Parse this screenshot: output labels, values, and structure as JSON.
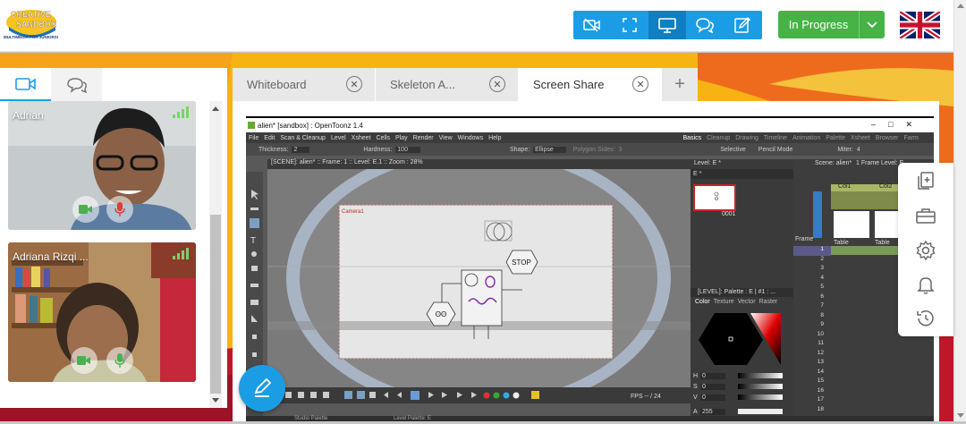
{
  "header": {
    "logo": {
      "line1": "CREATIVE",
      "line2": "SANDBOX",
      "tagline": "MULTIMEDIA FOR JUNIORS!"
    },
    "toolbar_icons": [
      "camera-off-icon",
      "fullscreen-icon",
      "screen-share-icon",
      "chat-icon",
      "edit-icon"
    ],
    "status": {
      "label": "In Progress"
    },
    "flag": "uk-flag-icon"
  },
  "left_panel": {
    "tabs": [
      "video-icon",
      "chat-icon"
    ],
    "participants": [
      {
        "name": "Adrian"
      },
      {
        "name": "Adriana Rizqi ..."
      }
    ]
  },
  "tabs": [
    {
      "label": "Whiteboard",
      "active": false
    },
    {
      "label": "Skeleton A...",
      "active": false
    },
    {
      "label": "Screen Share",
      "active": true
    }
  ],
  "add_tab_label": "+",
  "share": {
    "title": "alien* [sandbox] : OpenToonz 1.4",
    "menu": [
      "File",
      "Edit",
      "Scan & Cleanup",
      "Level",
      "Xsheet",
      "Cells",
      "Play",
      "Render",
      "View",
      "Windows",
      "Help"
    ],
    "rooms": [
      "Basics",
      "Cleanup",
      "Drawing",
      "Timeline",
      "Animation",
      "Palette",
      "Xsheet",
      "Browser",
      "Farm"
    ],
    "options": {
      "thickness_label": "Thickness:",
      "thickness_value": "2",
      "hardness_label": "Hardness:",
      "hardness_value": "100",
      "shape_label": "Shape:",
      "shape_value": "Ellipse",
      "polygon_label": "Polygon Sides:",
      "polygon_value": "3",
      "selective": "Selective",
      "pencil_mode": "Pencil Mode",
      "miter_label": "Miter:",
      "miter_value": "4"
    },
    "viewer_header": "[SCENE]: alien* :: Frame: 1 :: Level: E.1 :: Zoom : 28%",
    "camera_label": "Camera1",
    "stop_label": "STOP",
    "level_strip_header": "Level: E *",
    "level_strip_name": "E *",
    "level_frame": "0001",
    "palette_header": "[LEVEL]: Palette : E | #1 : ...",
    "palette_tabs": [
      "Color",
      "Texture",
      "Vector",
      "Raster"
    ],
    "hsv": [
      {
        "k": "H",
        "v": "0"
      },
      {
        "k": "S",
        "v": "0"
      },
      {
        "k": "V",
        "v": "0"
      },
      {
        "k": "A",
        "v": "255"
      }
    ],
    "fps_label": "FPS -- / 24",
    "xsheet_header": "Scene: alien*",
    "xsheet_frames": "1 Frame Level: E",
    "columns": [
      "Col1",
      "Col2"
    ],
    "column_labels": [
      "Table",
      "Table"
    ],
    "camera_column": "Camera1",
    "frame_label": "Frame",
    "rows": [
      "1",
      "2",
      "3",
      "4",
      "5",
      "6",
      "7",
      "8",
      "9",
      "10",
      "11",
      "12",
      "13",
      "14",
      "15",
      "16",
      "17",
      "18"
    ],
    "bottom_tabs": [
      "Studio Palette",
      "Level Palette: E"
    ]
  },
  "side_toolbar": [
    "copy-add-icon",
    "toolbox-icon",
    "settings-icon",
    "notification-icon",
    "history-icon"
  ],
  "colors": {
    "primary": "#1b9de5",
    "success": "#45b345",
    "accent_yellow": "#f6b312",
    "accent_orange": "#ee6b1e",
    "accent_red": "#c0162a"
  }
}
